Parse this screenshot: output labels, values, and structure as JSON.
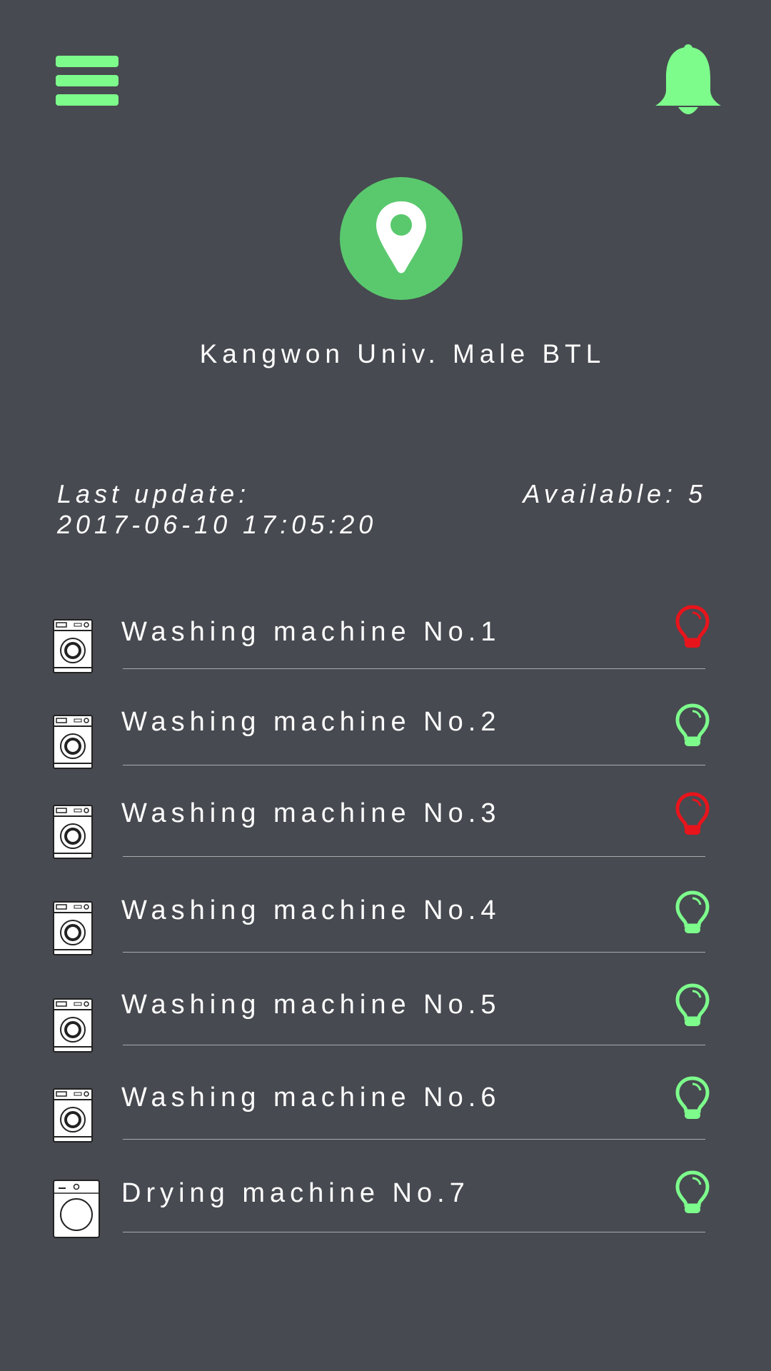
{
  "header": {
    "menu_icon": "hamburger-menu-icon",
    "notification_icon": "bell-icon"
  },
  "location": {
    "icon": "map-pin-icon",
    "name": "Kangwon Univ. Male BTL"
  },
  "status": {
    "last_update_label": "Last update:",
    "last_update_value": "2017-06-10 17:05:20",
    "available_text": "Available: 5"
  },
  "machines": [
    {
      "label": "Washing machine No.1",
      "type": "washer",
      "status": "in-use"
    },
    {
      "label": "Washing machine No.2",
      "type": "washer",
      "status": "available"
    },
    {
      "label": "Washing machine No.3",
      "type": "washer",
      "status": "in-use"
    },
    {
      "label": "Washing machine No.4",
      "type": "washer",
      "status": "available"
    },
    {
      "label": "Washing machine No.5",
      "type": "washer",
      "status": "available"
    },
    {
      "label": "Washing machine No.6",
      "type": "washer",
      "status": "available"
    },
    {
      "label": "Drying machine No.7",
      "type": "dryer",
      "status": "available"
    }
  ],
  "colors": {
    "background": "#474a50",
    "accent_green": "#7dfc8c",
    "pin_circle": "#5ac96e",
    "in_use_red": "#e8141c",
    "available_green": "#7dfc8c"
  }
}
